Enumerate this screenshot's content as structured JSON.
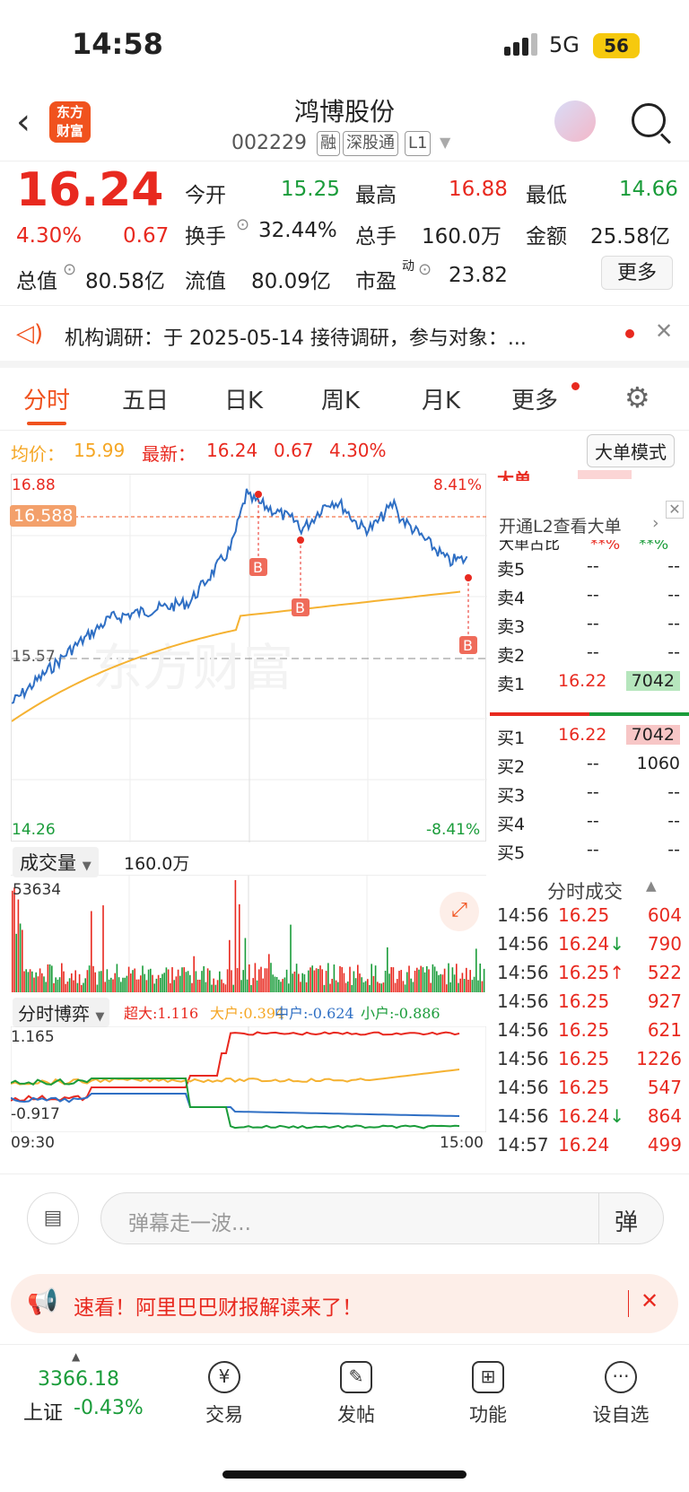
{
  "status": {
    "time": "14:58",
    "network": "5G",
    "battery": "56"
  },
  "header": {
    "title": "鸿博股份",
    "code": "002229",
    "tags": [
      "融",
      "深股通",
      "L1"
    ],
    "logo_line1": "东方",
    "logo_line2": "财富"
  },
  "quote": {
    "price": "16.24",
    "pct": "4.30%",
    "change": "0.67",
    "open_label": "今开",
    "open": "15.25",
    "high_label": "最高",
    "high": "16.88",
    "low_label": "最低",
    "low": "14.66",
    "turnover_label": "换手",
    "turnover": "32.44%",
    "volume_label": "总手",
    "volume": "160.0万",
    "amount_label": "金额",
    "amount": "25.58亿",
    "mktcap_label": "总值",
    "mktcap": "80.58亿",
    "float_label": "流值",
    "float": "80.09亿",
    "pe_label": "市盈",
    "pe_sup": "动",
    "pe": "23.82",
    "more": "更多"
  },
  "notice": {
    "text": "机构调研：于 2025-05-14 接待调研，参与对象：..."
  },
  "tabs": [
    "分时",
    "五日",
    "日K",
    "周K",
    "月K",
    "更多"
  ],
  "info": {
    "avg_label": "均价：",
    "avg": "15.99",
    "last_label": "最新：",
    "last": "16.24",
    "chg": "0.67",
    "pct": "4.30%",
    "mode": "大单模式"
  },
  "chart": {
    "high": "16.88",
    "high_pct": "8.41%",
    "low": "14.26",
    "low_pct": "-8.41%",
    "mid": "15.57",
    "marker": "16.588",
    "watermark": "东方财富",
    "buy_mark": "B"
  },
  "orderbook": {
    "l2": "开通L2查看大单",
    "big_title": "大单",
    "big_ratio_label": "大单占比",
    "big_ratio_values": [
      "**%",
      "**%"
    ],
    "sells": [
      {
        "label": "卖5",
        "price": "--",
        "vol": "--"
      },
      {
        "label": "卖4",
        "price": "--",
        "vol": "--"
      },
      {
        "label": "卖3",
        "price": "--",
        "vol": "--"
      },
      {
        "label": "卖2",
        "price": "--",
        "vol": "--"
      },
      {
        "label": "卖1",
        "price": "16.22",
        "vol": "7042"
      }
    ],
    "buys": [
      {
        "label": "买1",
        "price": "16.22",
        "vol": "7042"
      },
      {
        "label": "买2",
        "price": "--",
        "vol": "1060"
      },
      {
        "label": "买3",
        "price": "--",
        "vol": "--"
      },
      {
        "label": "买4",
        "price": "--",
        "vol": "--"
      },
      {
        "label": "买5",
        "price": "--",
        "vol": "--"
      }
    ],
    "trades_title": "分时成交",
    "trades": [
      {
        "t": "14:56",
        "p": "16.25",
        "v": "604",
        "arrow": ""
      },
      {
        "t": "14:56",
        "p": "16.24↓",
        "v": "790",
        "arrow": "down"
      },
      {
        "t": "14:56",
        "p": "16.25↑",
        "v": "522",
        "arrow": "up"
      },
      {
        "t": "14:56",
        "p": "16.25",
        "v": "927",
        "arrow": ""
      },
      {
        "t": "14:56",
        "p": "16.25",
        "v": "621",
        "arrow": ""
      },
      {
        "t": "14:56",
        "p": "16.25",
        "v": "1226",
        "arrow": ""
      },
      {
        "t": "14:56",
        "p": "16.25",
        "v": "547",
        "arrow": ""
      },
      {
        "t": "14:56",
        "p": "16.24↓",
        "v": "864",
        "arrow": "down"
      },
      {
        "t": "14:57",
        "p": "16.24",
        "v": "499",
        "arrow": ""
      }
    ]
  },
  "volume": {
    "label": "成交量",
    "total": "160.0万",
    "max": "53634"
  },
  "bo": {
    "label": "分时博弈",
    "super": "超大:1.116",
    "big": "大户:0.394",
    "mid": "中户:-0.624",
    "small": "小户:-0.886",
    "top": "1.165",
    "bottom": "-0.917",
    "start": "09:30",
    "end": "15:00"
  },
  "barrage": {
    "placeholder": "弹幕走一波...",
    "btn": "弹"
  },
  "banner": {
    "text": "速看！阿里巴巴财报解读来了！"
  },
  "bottom": {
    "index_value": "3366.18",
    "index_name": "上证",
    "index_pct": "-0.43%",
    "items": [
      "交易",
      "发帖",
      "功能",
      "设自选"
    ]
  },
  "colors": {
    "up": "#e8291f",
    "down": "#1a9c3a",
    "accent": "#f0521e",
    "avg_line": "#f5b232",
    "price_line": "#2f6fc4"
  }
}
